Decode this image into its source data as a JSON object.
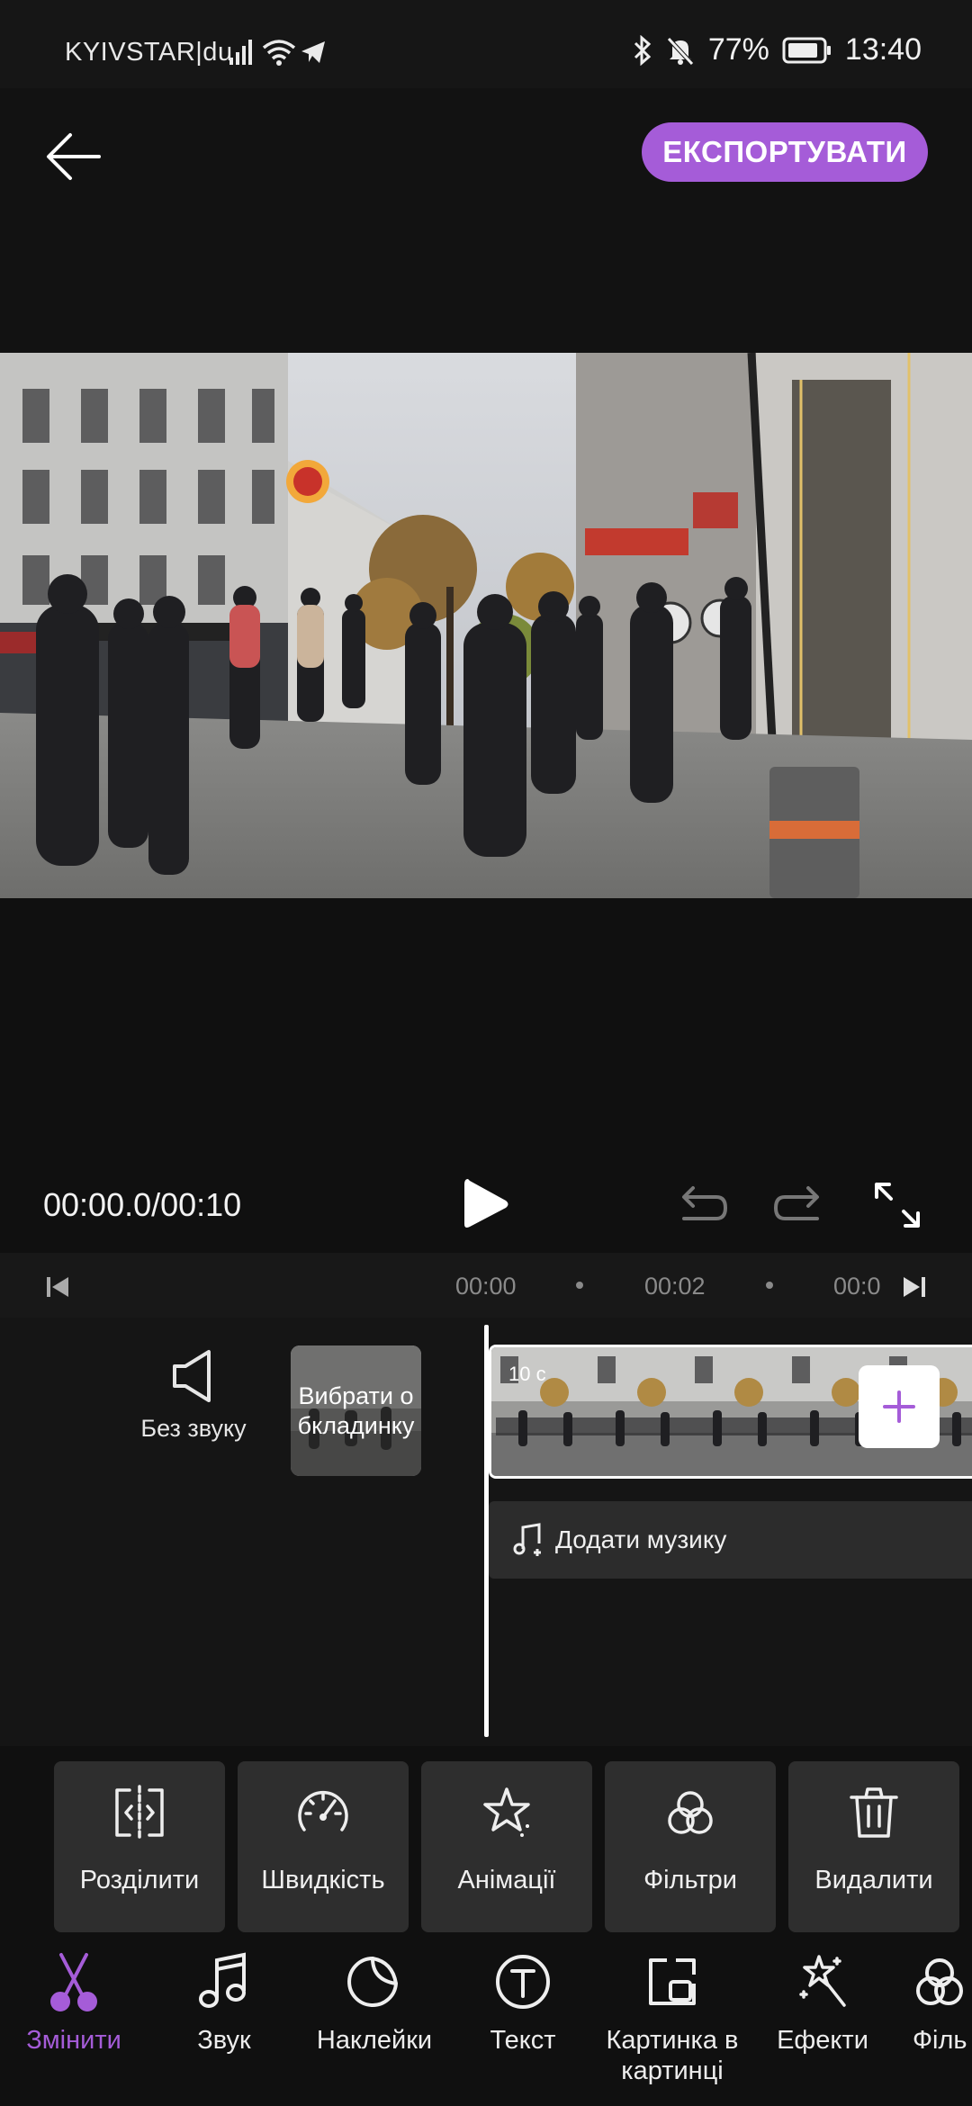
{
  "status_bar": {
    "carrier": "KYIVSTAR|du",
    "battery": "77%",
    "time": "13:40",
    "icons": [
      "signal-icon",
      "wifi-icon",
      "telegram-icon",
      "bluetooth-icon",
      "mute-bell-icon",
      "battery-icon"
    ]
  },
  "header": {
    "back_icon": "arrow-left-icon",
    "export_label": "ЕКСПОРТУВАТИ"
  },
  "player": {
    "timecode": "00:00.0/00:10"
  },
  "timeline": {
    "ruler_labels": [
      "00:00",
      "00:02",
      "00:0"
    ],
    "mute_label": "Без звуку",
    "cover_label": "Вибрати о бкладинку",
    "clip_duration": "10 с",
    "add_music_label": "Додати музику"
  },
  "tools": [
    {
      "label": "Розділити",
      "icon": "split-icon"
    },
    {
      "label": "Швидкість",
      "icon": "speedometer-icon"
    },
    {
      "label": "Анімації",
      "icon": "star-sparkle-icon"
    },
    {
      "label": "Фільтри",
      "icon": "filters-circles-icon"
    },
    {
      "label": "Видалити",
      "icon": "trash-icon"
    }
  ],
  "bottom_nav": [
    {
      "label": "Змінити",
      "icon": "scissors-icon",
      "active": true
    },
    {
      "label": "Звук",
      "icon": "music-note-icon"
    },
    {
      "label": "Наклейки",
      "icon": "sticker-icon"
    },
    {
      "label": "Текст",
      "icon": "text-circle-icon"
    },
    {
      "label": "Картинка в картинці",
      "icon": "picture-in-picture-icon"
    },
    {
      "label": "Ефекти",
      "icon": "magic-wand-icon"
    },
    {
      "label": "Філь",
      "icon": "filters-circles-icon"
    }
  ],
  "colors": {
    "accent": "#a55cd8",
    "background": "#101010"
  }
}
